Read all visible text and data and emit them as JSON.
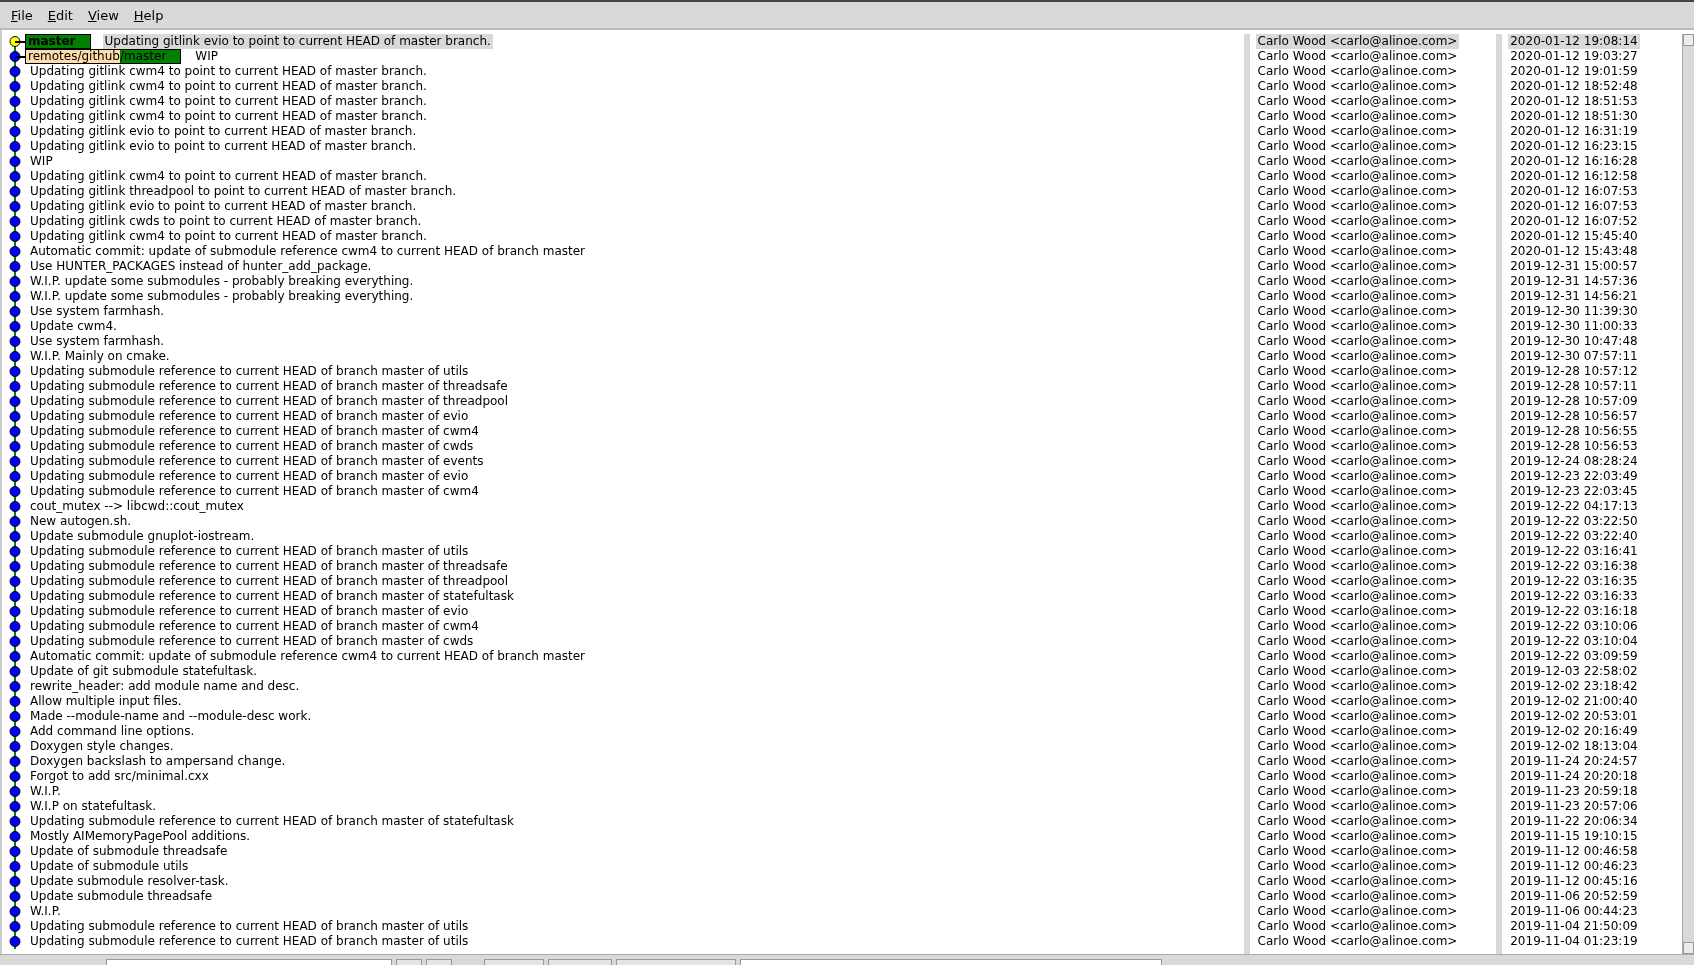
{
  "menu": [
    "File",
    "Edit",
    "View",
    "Help"
  ],
  "rows": [
    {
      "message": "Updating gitlink evio to point to current HEAD of master branch.",
      "author": "Carlo Wood <carlo@alinoe.com>",
      "date": "2020-01-12 19:08:14",
      "selected": true,
      "head": true,
      "refs": [
        {
          "kind": "local",
          "label": "master"
        }
      ]
    },
    {
      "message": "WIP",
      "author": "Carlo Wood <carlo@alinoe.com>",
      "date": "2020-01-12 19:03:27",
      "selected": false,
      "head": false,
      "refs": [
        {
          "kind": "remote",
          "prefix": "remotes/github",
          "label": "/master"
        }
      ]
    },
    {
      "message": "Updating gitlink cwm4 to point to current HEAD of master branch.",
      "author": "Carlo Wood <carlo@alinoe.com>",
      "date": "2020-01-12 19:01:59",
      "selected": false,
      "head": false
    },
    {
      "message": "Updating gitlink cwm4 to point to current HEAD of master branch.",
      "author": "Carlo Wood <carlo@alinoe.com>",
      "date": "2020-01-12 18:52:48",
      "selected": false,
      "head": false
    },
    {
      "message": "Updating gitlink cwm4 to point to current HEAD of master branch.",
      "author": "Carlo Wood <carlo@alinoe.com>",
      "date": "2020-01-12 18:51:53",
      "selected": false,
      "head": false
    },
    {
      "message": "Updating gitlink cwm4 to point to current HEAD of master branch.",
      "author": "Carlo Wood <carlo@alinoe.com>",
      "date": "2020-01-12 18:51:30",
      "selected": false,
      "head": false
    },
    {
      "message": "Updating gitlink evio to point to current HEAD of master branch.",
      "author": "Carlo Wood <carlo@alinoe.com>",
      "date": "2020-01-12 16:31:19",
      "selected": false,
      "head": false
    },
    {
      "message": "Updating gitlink evio to point to current HEAD of master branch.",
      "author": "Carlo Wood <carlo@alinoe.com>",
      "date": "2020-01-12 16:23:15",
      "selected": false,
      "head": false
    },
    {
      "message": "WIP",
      "author": "Carlo Wood <carlo@alinoe.com>",
      "date": "2020-01-12 16:16:28",
      "selected": false,
      "head": false
    },
    {
      "message": "Updating gitlink cwm4 to point to current HEAD of master branch.",
      "author": "Carlo Wood <carlo@alinoe.com>",
      "date": "2020-01-12 16:12:58",
      "selected": false,
      "head": false
    },
    {
      "message": "Updating gitlink threadpool to point to current HEAD of master branch.",
      "author": "Carlo Wood <carlo@alinoe.com>",
      "date": "2020-01-12 16:07:53",
      "selected": false,
      "head": false
    },
    {
      "message": "Updating gitlink evio to point to current HEAD of master branch.",
      "author": "Carlo Wood <carlo@alinoe.com>",
      "date": "2020-01-12 16:07:53",
      "selected": false,
      "head": false
    },
    {
      "message": "Updating gitlink cwds to point to current HEAD of master branch.",
      "author": "Carlo Wood <carlo@alinoe.com>",
      "date": "2020-01-12 16:07:52",
      "selected": false,
      "head": false
    },
    {
      "message": "Updating gitlink cwm4 to point to current HEAD of master branch.",
      "author": "Carlo Wood <carlo@alinoe.com>",
      "date": "2020-01-12 15:45:40",
      "selected": false,
      "head": false
    },
    {
      "message": "Automatic commit: update of submodule reference cwm4 to current HEAD of branch master",
      "author": "Carlo Wood <carlo@alinoe.com>",
      "date": "2020-01-12 15:43:48",
      "selected": false,
      "head": false
    },
    {
      "message": "Use HUNTER_PACKAGES instead of hunter_add_package.",
      "author": "Carlo Wood <carlo@alinoe.com>",
      "date": "2019-12-31 15:00:57",
      "selected": false,
      "head": false
    },
    {
      "message": "W.I.P. update some submodules - probably breaking everything.",
      "author": "Carlo Wood <carlo@alinoe.com>",
      "date": "2019-12-31 14:57:36",
      "selected": false,
      "head": false
    },
    {
      "message": "W.I.P. update some submodules - probably breaking everything.",
      "author": "Carlo Wood <carlo@alinoe.com>",
      "date": "2019-12-31 14:56:21",
      "selected": false,
      "head": false
    },
    {
      "message": "Use system farmhash.",
      "author": "Carlo Wood <carlo@alinoe.com>",
      "date": "2019-12-30 11:39:30",
      "selected": false,
      "head": false
    },
    {
      "message": "Update cwm4.",
      "author": "Carlo Wood <carlo@alinoe.com>",
      "date": "2019-12-30 11:00:33",
      "selected": false,
      "head": false
    },
    {
      "message": "Use system farmhash.",
      "author": "Carlo Wood <carlo@alinoe.com>",
      "date": "2019-12-30 10:47:48",
      "selected": false,
      "head": false
    },
    {
      "message": "W.I.P. Mainly on cmake.",
      "author": "Carlo Wood <carlo@alinoe.com>",
      "date": "2019-12-30 07:57:11",
      "selected": false,
      "head": false
    },
    {
      "message": "Updating submodule reference to current HEAD of branch master of utils",
      "author": "Carlo Wood <carlo@alinoe.com>",
      "date": "2019-12-28 10:57:12",
      "selected": false,
      "head": false
    },
    {
      "message": "Updating submodule reference to current HEAD of branch master of threadsafe",
      "author": "Carlo Wood <carlo@alinoe.com>",
      "date": "2019-12-28 10:57:11",
      "selected": false,
      "head": false
    },
    {
      "message": "Updating submodule reference to current HEAD of branch master of threadpool",
      "author": "Carlo Wood <carlo@alinoe.com>",
      "date": "2019-12-28 10:57:09",
      "selected": false,
      "head": false
    },
    {
      "message": "Updating submodule reference to current HEAD of branch master of evio",
      "author": "Carlo Wood <carlo@alinoe.com>",
      "date": "2019-12-28 10:56:57",
      "selected": false,
      "head": false
    },
    {
      "message": "Updating submodule reference to current HEAD of branch master of cwm4",
      "author": "Carlo Wood <carlo@alinoe.com>",
      "date": "2019-12-28 10:56:55",
      "selected": false,
      "head": false
    },
    {
      "message": "Updating submodule reference to current HEAD of branch master of cwds",
      "author": "Carlo Wood <carlo@alinoe.com>",
      "date": "2019-12-28 10:56:53",
      "selected": false,
      "head": false
    },
    {
      "message": "Updating submodule reference to current HEAD of branch master of events",
      "author": "Carlo Wood <carlo@alinoe.com>",
      "date": "2019-12-24 08:28:24",
      "selected": false,
      "head": false
    },
    {
      "message": "Updating submodule reference to current HEAD of branch master of evio",
      "author": "Carlo Wood <carlo@alinoe.com>",
      "date": "2019-12-23 22:03:49",
      "selected": false,
      "head": false
    },
    {
      "message": "Updating submodule reference to current HEAD of branch master of cwm4",
      "author": "Carlo Wood <carlo@alinoe.com>",
      "date": "2019-12-23 22:03:45",
      "selected": false,
      "head": false
    },
    {
      "message": "cout_mutex --> libcwd::cout_mutex",
      "author": "Carlo Wood <carlo@alinoe.com>",
      "date": "2019-12-22 04:17:13",
      "selected": false,
      "head": false
    },
    {
      "message": "New autogen.sh.",
      "author": "Carlo Wood <carlo@alinoe.com>",
      "date": "2019-12-22 03:22:50",
      "selected": false,
      "head": false
    },
    {
      "message": "Update submodule gnuplot-iostream.",
      "author": "Carlo Wood <carlo@alinoe.com>",
      "date": "2019-12-22 03:22:40",
      "selected": false,
      "head": false
    },
    {
      "message": "Updating submodule reference to current HEAD of branch master of utils",
      "author": "Carlo Wood <carlo@alinoe.com>",
      "date": "2019-12-22 03:16:41",
      "selected": false,
      "head": false
    },
    {
      "message": "Updating submodule reference to current HEAD of branch master of threadsafe",
      "author": "Carlo Wood <carlo@alinoe.com>",
      "date": "2019-12-22 03:16:38",
      "selected": false,
      "head": false
    },
    {
      "message": "Updating submodule reference to current HEAD of branch master of threadpool",
      "author": "Carlo Wood <carlo@alinoe.com>",
      "date": "2019-12-22 03:16:35",
      "selected": false,
      "head": false
    },
    {
      "message": "Updating submodule reference to current HEAD of branch master of statefultask",
      "author": "Carlo Wood <carlo@alinoe.com>",
      "date": "2019-12-22 03:16:33",
      "selected": false,
      "head": false
    },
    {
      "message": "Updating submodule reference to current HEAD of branch master of evio",
      "author": "Carlo Wood <carlo@alinoe.com>",
      "date": "2019-12-22 03:16:18",
      "selected": false,
      "head": false
    },
    {
      "message": "Updating submodule reference to current HEAD of branch master of cwm4",
      "author": "Carlo Wood <carlo@alinoe.com>",
      "date": "2019-12-22 03:10:06",
      "selected": false,
      "head": false
    },
    {
      "message": "Updating submodule reference to current HEAD of branch master of cwds",
      "author": "Carlo Wood <carlo@alinoe.com>",
      "date": "2019-12-22 03:10:04",
      "selected": false,
      "head": false
    },
    {
      "message": "Automatic commit: update of submodule reference cwm4 to current HEAD of branch master",
      "author": "Carlo Wood <carlo@alinoe.com>",
      "date": "2019-12-22 03:09:59",
      "selected": false,
      "head": false
    },
    {
      "message": "Update of git submodule statefultask.",
      "author": "Carlo Wood <carlo@alinoe.com>",
      "date": "2019-12-03 22:58:02",
      "selected": false,
      "head": false
    },
    {
      "message": "rewrite_header: add module name and desc.",
      "author": "Carlo Wood <carlo@alinoe.com>",
      "date": "2019-12-02 23:18:42",
      "selected": false,
      "head": false
    },
    {
      "message": "Allow multiple input files.",
      "author": "Carlo Wood <carlo@alinoe.com>",
      "date": "2019-12-02 21:00:40",
      "selected": false,
      "head": false
    },
    {
      "message": "Made --module-name and --module-desc work.",
      "author": "Carlo Wood <carlo@alinoe.com>",
      "date": "2019-12-02 20:53:01",
      "selected": false,
      "head": false
    },
    {
      "message": "Add command line options.",
      "author": "Carlo Wood <carlo@alinoe.com>",
      "date": "2019-12-02 20:16:49",
      "selected": false,
      "head": false
    },
    {
      "message": "Doxygen style changes.",
      "author": "Carlo Wood <carlo@alinoe.com>",
      "date": "2019-12-02 18:13:04",
      "selected": false,
      "head": false
    },
    {
      "message": "Doxygen backslash to ampersand change.",
      "author": "Carlo Wood <carlo@alinoe.com>",
      "date": "2019-11-24 20:24:57",
      "selected": false,
      "head": false
    },
    {
      "message": "Forgot to add src/minimal.cxx",
      "author": "Carlo Wood <carlo@alinoe.com>",
      "date": "2019-11-24 20:20:18",
      "selected": false,
      "head": false
    },
    {
      "message": "W.I.P.",
      "author": "Carlo Wood <carlo@alinoe.com>",
      "date": "2019-11-23 20:59:18",
      "selected": false,
      "head": false
    },
    {
      "message": "W.I.P on statefultask.",
      "author": "Carlo Wood <carlo@alinoe.com>",
      "date": "2019-11-23 20:57:06",
      "selected": false,
      "head": false
    },
    {
      "message": "Updating submodule reference to current HEAD of branch master of statefultask",
      "author": "Carlo Wood <carlo@alinoe.com>",
      "date": "2019-11-22 20:06:34",
      "selected": false,
      "head": false
    },
    {
      "message": "Mostly AIMemoryPagePool additions.",
      "author": "Carlo Wood <carlo@alinoe.com>",
      "date": "2019-11-15 19:10:15",
      "selected": false,
      "head": false
    },
    {
      "message": "Update of submodule threadsafe",
      "author": "Carlo Wood <carlo@alinoe.com>",
      "date": "2019-11-12 00:46:58",
      "selected": false,
      "head": false
    },
    {
      "message": "Update of submodule utils",
      "author": "Carlo Wood <carlo@alinoe.com>",
      "date": "2019-11-12 00:46:23",
      "selected": false,
      "head": false
    },
    {
      "message": "Update submodule resolver-task.",
      "author": "Carlo Wood <carlo@alinoe.com>",
      "date": "2019-11-12 00:45:16",
      "selected": false,
      "head": false
    },
    {
      "message": "Update submodule threadsafe",
      "author": "Carlo Wood <carlo@alinoe.com>",
      "date": "2019-11-06 20:52:59",
      "selected": false,
      "head": false
    },
    {
      "message": "W.I.P.",
      "author": "Carlo Wood <carlo@alinoe.com>",
      "date": "2019-11-06 00:44:23",
      "selected": false,
      "head": false
    },
    {
      "message": "Updating submodule reference to current HEAD of branch master of utils",
      "author": "Carlo Wood <carlo@alinoe.com>",
      "date": "2019-11-04 21:50:09",
      "selected": false,
      "head": false
    },
    {
      "message": "Updating submodule reference to current HEAD of branch master of utils",
      "author": "Carlo Wood <carlo@alinoe.com>",
      "date": "2019-11-04 01:23:19",
      "selected": false,
      "head": false
    }
  ]
}
